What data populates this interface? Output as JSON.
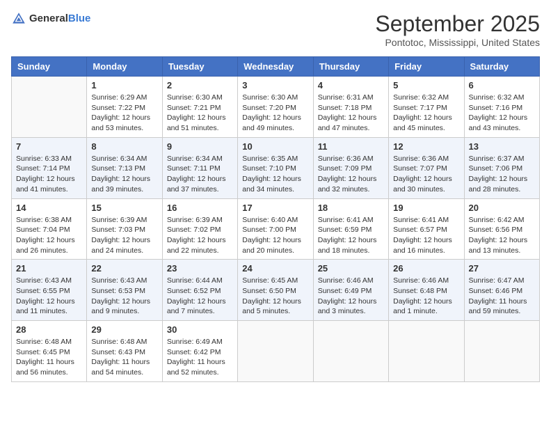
{
  "header": {
    "logo_general": "General",
    "logo_blue": "Blue",
    "month_title": "September 2025",
    "location": "Pontotoc, Mississippi, United States"
  },
  "weekdays": [
    "Sunday",
    "Monday",
    "Tuesday",
    "Wednesday",
    "Thursday",
    "Friday",
    "Saturday"
  ],
  "weeks": [
    [
      {
        "day": "",
        "info": ""
      },
      {
        "day": "1",
        "info": "Sunrise: 6:29 AM\nSunset: 7:22 PM\nDaylight: 12 hours\nand 53 minutes."
      },
      {
        "day": "2",
        "info": "Sunrise: 6:30 AM\nSunset: 7:21 PM\nDaylight: 12 hours\nand 51 minutes."
      },
      {
        "day": "3",
        "info": "Sunrise: 6:30 AM\nSunset: 7:20 PM\nDaylight: 12 hours\nand 49 minutes."
      },
      {
        "day": "4",
        "info": "Sunrise: 6:31 AM\nSunset: 7:18 PM\nDaylight: 12 hours\nand 47 minutes."
      },
      {
        "day": "5",
        "info": "Sunrise: 6:32 AM\nSunset: 7:17 PM\nDaylight: 12 hours\nand 45 minutes."
      },
      {
        "day": "6",
        "info": "Sunrise: 6:32 AM\nSunset: 7:16 PM\nDaylight: 12 hours\nand 43 minutes."
      }
    ],
    [
      {
        "day": "7",
        "info": "Sunrise: 6:33 AM\nSunset: 7:14 PM\nDaylight: 12 hours\nand 41 minutes."
      },
      {
        "day": "8",
        "info": "Sunrise: 6:34 AM\nSunset: 7:13 PM\nDaylight: 12 hours\nand 39 minutes."
      },
      {
        "day": "9",
        "info": "Sunrise: 6:34 AM\nSunset: 7:11 PM\nDaylight: 12 hours\nand 37 minutes."
      },
      {
        "day": "10",
        "info": "Sunrise: 6:35 AM\nSunset: 7:10 PM\nDaylight: 12 hours\nand 34 minutes."
      },
      {
        "day": "11",
        "info": "Sunrise: 6:36 AM\nSunset: 7:09 PM\nDaylight: 12 hours\nand 32 minutes."
      },
      {
        "day": "12",
        "info": "Sunrise: 6:36 AM\nSunset: 7:07 PM\nDaylight: 12 hours\nand 30 minutes."
      },
      {
        "day": "13",
        "info": "Sunrise: 6:37 AM\nSunset: 7:06 PM\nDaylight: 12 hours\nand 28 minutes."
      }
    ],
    [
      {
        "day": "14",
        "info": "Sunrise: 6:38 AM\nSunset: 7:04 PM\nDaylight: 12 hours\nand 26 minutes."
      },
      {
        "day": "15",
        "info": "Sunrise: 6:39 AM\nSunset: 7:03 PM\nDaylight: 12 hours\nand 24 minutes."
      },
      {
        "day": "16",
        "info": "Sunrise: 6:39 AM\nSunset: 7:02 PM\nDaylight: 12 hours\nand 22 minutes."
      },
      {
        "day": "17",
        "info": "Sunrise: 6:40 AM\nSunset: 7:00 PM\nDaylight: 12 hours\nand 20 minutes."
      },
      {
        "day": "18",
        "info": "Sunrise: 6:41 AM\nSunset: 6:59 PM\nDaylight: 12 hours\nand 18 minutes."
      },
      {
        "day": "19",
        "info": "Sunrise: 6:41 AM\nSunset: 6:57 PM\nDaylight: 12 hours\nand 16 minutes."
      },
      {
        "day": "20",
        "info": "Sunrise: 6:42 AM\nSunset: 6:56 PM\nDaylight: 12 hours\nand 13 minutes."
      }
    ],
    [
      {
        "day": "21",
        "info": "Sunrise: 6:43 AM\nSunset: 6:55 PM\nDaylight: 12 hours\nand 11 minutes."
      },
      {
        "day": "22",
        "info": "Sunrise: 6:43 AM\nSunset: 6:53 PM\nDaylight: 12 hours\nand 9 minutes."
      },
      {
        "day": "23",
        "info": "Sunrise: 6:44 AM\nSunset: 6:52 PM\nDaylight: 12 hours\nand 7 minutes."
      },
      {
        "day": "24",
        "info": "Sunrise: 6:45 AM\nSunset: 6:50 PM\nDaylight: 12 hours\nand 5 minutes."
      },
      {
        "day": "25",
        "info": "Sunrise: 6:46 AM\nSunset: 6:49 PM\nDaylight: 12 hours\nand 3 minutes."
      },
      {
        "day": "26",
        "info": "Sunrise: 6:46 AM\nSunset: 6:48 PM\nDaylight: 12 hours\nand 1 minute."
      },
      {
        "day": "27",
        "info": "Sunrise: 6:47 AM\nSunset: 6:46 PM\nDaylight: 11 hours\nand 59 minutes."
      }
    ],
    [
      {
        "day": "28",
        "info": "Sunrise: 6:48 AM\nSunset: 6:45 PM\nDaylight: 11 hours\nand 56 minutes."
      },
      {
        "day": "29",
        "info": "Sunrise: 6:48 AM\nSunset: 6:43 PM\nDaylight: 11 hours\nand 54 minutes."
      },
      {
        "day": "30",
        "info": "Sunrise: 6:49 AM\nSunset: 6:42 PM\nDaylight: 11 hours\nand 52 minutes."
      },
      {
        "day": "",
        "info": ""
      },
      {
        "day": "",
        "info": ""
      },
      {
        "day": "",
        "info": ""
      },
      {
        "day": "",
        "info": ""
      }
    ]
  ]
}
